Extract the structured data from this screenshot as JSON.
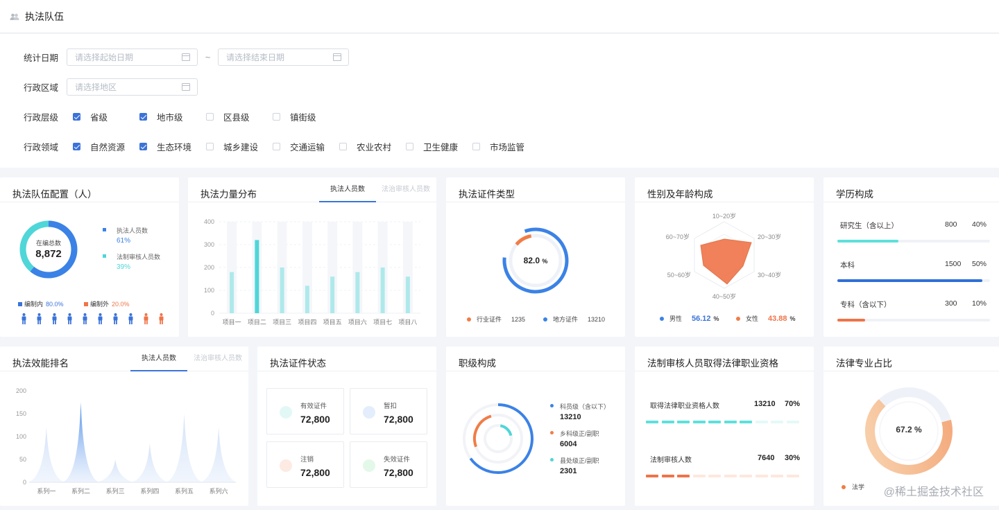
{
  "header": {
    "title": "执法队伍",
    "icon": "people-icon"
  },
  "filters": {
    "date_label": "统计日期",
    "start_placeholder": "请选择起始日期",
    "end_placeholder": "请选择结束日期",
    "tilde": "~",
    "region_label": "行政区域",
    "region_placeholder": "请选择地区",
    "level_label": "行政层级",
    "levels": [
      {
        "label": "省级",
        "checked": true
      },
      {
        "label": "地市级",
        "checked": true
      },
      {
        "label": "区县级",
        "checked": false
      },
      {
        "label": "镇街级",
        "checked": false
      }
    ],
    "field_label": "行政领域",
    "fields": [
      {
        "label": "自然资源",
        "checked": true
      },
      {
        "label": "生态环境",
        "checked": true
      },
      {
        "label": "城乡建设",
        "checked": false
      },
      {
        "label": "交通运输",
        "checked": false
      },
      {
        "label": "农业农村",
        "checked": false
      },
      {
        "label": "卫生健康",
        "checked": false
      },
      {
        "label": "市场监管",
        "checked": false
      }
    ]
  },
  "config": {
    "title": "执法队伍配置（人）",
    "center_label": "在编总数",
    "center_value": "8,872",
    "legend": [
      {
        "label": "执法人员数",
        "pct": "61%",
        "color": "#3b82e6"
      },
      {
        "label": "法制审核人员数",
        "pct": "39%",
        "color": "#4fd6d8"
      }
    ],
    "within_label": "编制内",
    "within_pct": "80.0%",
    "outside_label": "编制外",
    "outside_pct": "20.0%"
  },
  "force": {
    "title": "执法力量分布",
    "tab_active": "执法人员数",
    "tab_inactive": "法治审核人员数"
  },
  "certtype": {
    "title": "执法证件类型",
    "center": "82.0",
    "unit": "%",
    "legend": [
      {
        "label": "行业证件",
        "value": "1235",
        "color": "#f07d47"
      },
      {
        "label": "地方证件",
        "value": "13210",
        "color": "#3b82e6"
      }
    ]
  },
  "gender": {
    "title": "性别及年龄构成",
    "axes": [
      "10~20岁",
      "20~30岁",
      "30~40岁",
      "40~50岁",
      "50~60岁",
      "60~70岁"
    ],
    "male_label": "男性",
    "male_pct": "56.12",
    "female_label": "女性",
    "female_pct": "43.88",
    "pct_unit": "%"
  },
  "education": {
    "title": "学历构成",
    "items": [
      {
        "label": "研究生（含以上）",
        "count": "800",
        "pct": "40%",
        "fill": 0.4,
        "color": "#5de0dc"
      },
      {
        "label": "本科",
        "count": "1500",
        "pct": "50%",
        "fill": 0.95,
        "color": "#2f6fd8"
      },
      {
        "label": "专科（含以下）",
        "count": "300",
        "pct": "10%",
        "fill": 0.18,
        "color": "#ef7449"
      }
    ]
  },
  "efficiency": {
    "title": "执法效能排名",
    "tab_active": "执法人员数",
    "tab_inactive": "法治审核人员数"
  },
  "certstatus": {
    "title": "执法证件状态",
    "boxes": [
      {
        "label": "有效证件",
        "value": "72,800",
        "icon": "valid-cert-icon"
      },
      {
        "label": "暂扣",
        "value": "72,800",
        "icon": "suspended-icon"
      },
      {
        "label": "注销",
        "value": "72,800",
        "icon": "cancelled-icon"
      },
      {
        "label": "失效证件",
        "value": "72,800",
        "icon": "expired-icon"
      }
    ]
  },
  "rank": {
    "title": "职级构成",
    "items": [
      {
        "label": "科员级（含以下）",
        "value": "13210",
        "color": "#3b82e6"
      },
      {
        "label": "乡科级正/副职",
        "value": "6004",
        "color": "#f07d47"
      },
      {
        "label": "县处级正/副职",
        "value": "2301",
        "color": "#4fd6d8"
      }
    ]
  },
  "lawqual": {
    "title": "法制审核人员取得法律职业资格",
    "row1_label": "取得法律职业资格人数",
    "row1_value": "13210",
    "row1_pct": "70%",
    "row2_label": "法制审核人数",
    "row2_value": "7640",
    "row2_pct": "30%"
  },
  "lawmajor": {
    "title": "法律专业占比",
    "center": "67.2 %",
    "legend": "法学"
  },
  "watermark": "@稀土掘金技术社区",
  "chart_data": [
    {
      "type": "bar",
      "title": "执法力量分布",
      "categories": [
        "项目一",
        "项目二",
        "项目三",
        "项目四",
        "项目五",
        "项目六",
        "项目七",
        "项目八"
      ],
      "values": [
        180,
        320,
        200,
        120,
        160,
        180,
        200,
        160
      ],
      "ylim": [
        0,
        400
      ],
      "yticks": [
        "0",
        "100",
        "200",
        "300",
        "400"
      ]
    },
    {
      "type": "area",
      "title": "执法效能排名",
      "categories": [
        "系列一",
        "系列二",
        "系列三",
        "系列四",
        "系列五",
        "系列六"
      ],
      "values": [
        120,
        175,
        50,
        85,
        150,
        120
      ],
      "ylim": [
        0,
        200
      ],
      "yticks": [
        "0",
        "50",
        "100",
        "150",
        "200"
      ]
    }
  ]
}
